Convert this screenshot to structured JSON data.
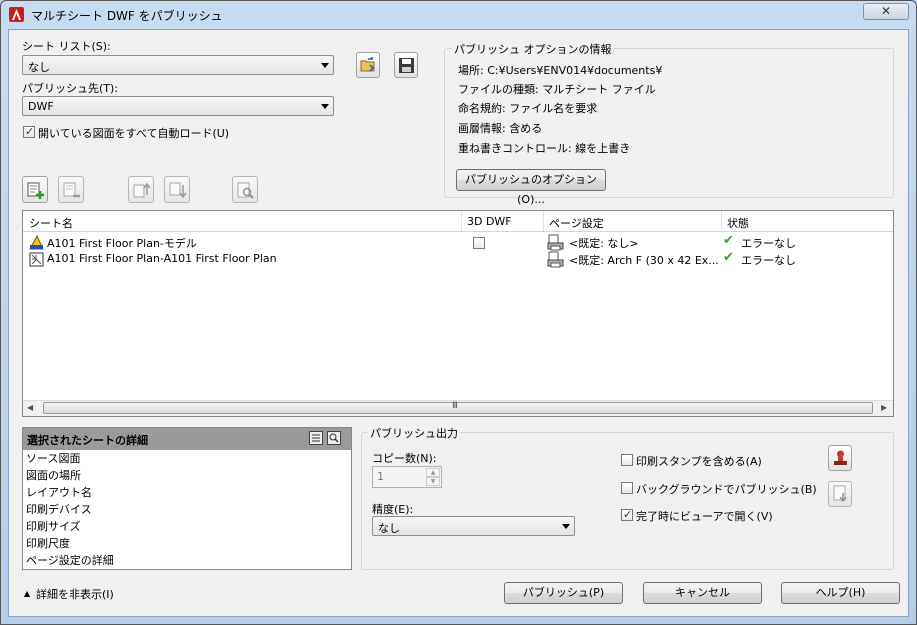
{
  "window": {
    "title": "マルチシート DWF をパブリッシュ",
    "close_glyph": "✕"
  },
  "sheet_list": {
    "label": "シート リスト(S):",
    "value": "なし"
  },
  "publish_to": {
    "label": "パブリッシュ先(T):",
    "value": "DWF"
  },
  "auto_load": {
    "label": "開いている図面をすべて自動ロード(U)",
    "checked": true
  },
  "options_info": {
    "title": "パブリッシュ オプションの情報",
    "lines": [
      "場所: C:¥Users¥ENV014¥documents¥",
      "ファイルの種類: マルチシート ファイル",
      "命名規約: ファイル名を要求",
      "画層情報: 含める",
      "重ね書きコントロール: 線を上書き"
    ],
    "button": "パブリッシュのオプション(O)..."
  },
  "sheet_table": {
    "columns": [
      "シート名",
      "3D DWF",
      "ページ設定",
      "状態"
    ],
    "rows": [
      {
        "name": "A101 First Floor Plan-モデル",
        "dwf3d": false,
        "page_setup": "<既定: なし>",
        "status": "エラーなし",
        "icon": "model-sheet-icon"
      },
      {
        "name": "A101 First Floor Plan-A101 First Floor Plan",
        "dwf3d": false,
        "page_setup": "<既定: Arch F (30 x 42 Ex...",
        "status": "エラーなし",
        "icon": "layout-sheet-icon"
      }
    ],
    "scroll_grip": "III"
  },
  "details": {
    "title": "選択されたシートの詳細",
    "items": [
      "ソース図面",
      "図面の場所",
      "レイアウト名",
      "印刷デバイス",
      "印刷サイズ",
      "印刷尺度",
      "ページ設定の詳細"
    ]
  },
  "output": {
    "title": "パブリッシュ出力",
    "copies_label": "コピー数(N):",
    "copies_value": "1",
    "precision_label": "精度(E):",
    "precision_value": "なし",
    "stamp": {
      "label": "印刷スタンプを含める(A)",
      "checked": false
    },
    "background": {
      "label": "バックグラウンドでパブリッシュ(B)",
      "checked": false
    },
    "open_viewer": {
      "label": "完了時にビューアで開く(V)",
      "checked": true
    }
  },
  "footer": {
    "hide_details": "詳細を非表示(I)",
    "publish": "パブリッシュ(P)",
    "cancel": "キャンセル",
    "help": "ヘルプ(H)"
  },
  "colors": {
    "accent": "#3aa037",
    "title_bg": "#c8dcf1",
    "details_header": "#9a9a9a"
  }
}
